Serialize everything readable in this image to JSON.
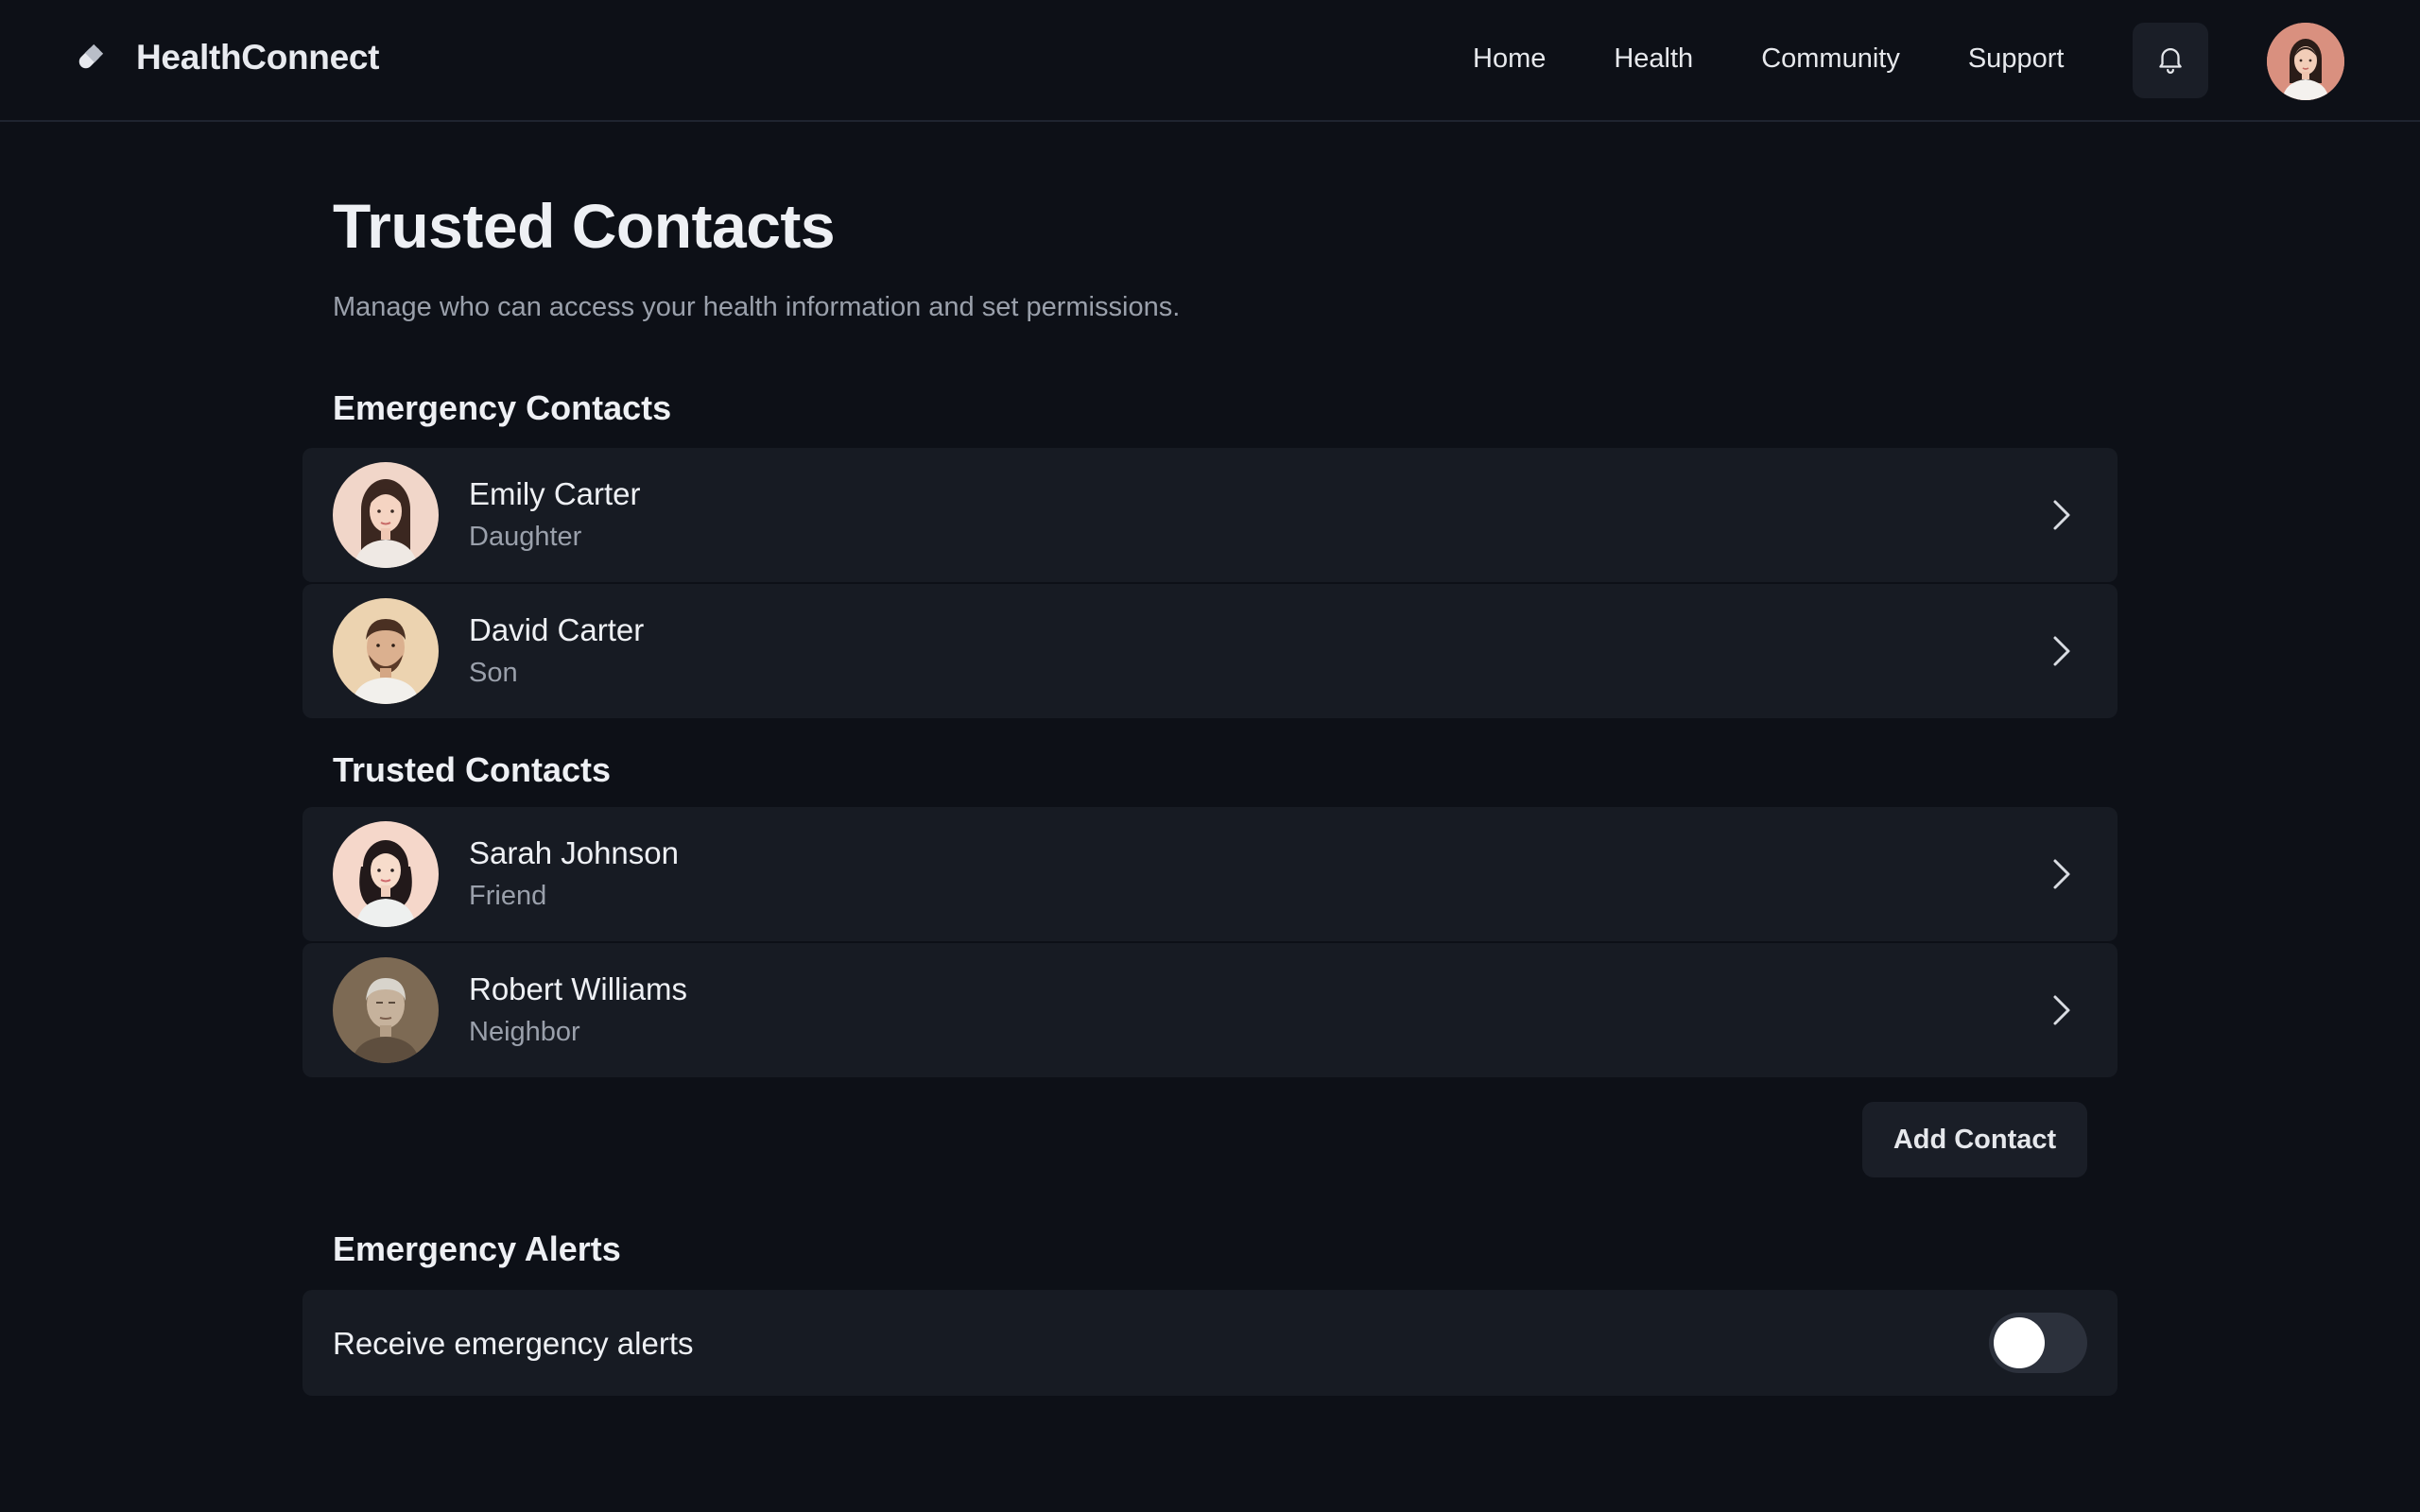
{
  "header": {
    "brand": "HealthConnect",
    "brand_icon": "pill-icon",
    "nav": [
      "Home",
      "Health",
      "Community",
      "Support"
    ],
    "bell_icon": "bell-icon",
    "user_avatar": "user-avatar"
  },
  "page": {
    "title": "Trusted Contacts",
    "subtitle": "Manage who can access your health information and set permissions."
  },
  "emergency": {
    "title": "Emergency Contacts",
    "contacts": [
      {
        "name": "Emily Carter",
        "relation": "Daughter"
      },
      {
        "name": "David Carter",
        "relation": "Son"
      }
    ]
  },
  "trusted": {
    "title": "Trusted Contacts",
    "contacts": [
      {
        "name": "Sarah Johnson",
        "relation": "Friend"
      },
      {
        "name": "Robert Williams",
        "relation": "Neighbor"
      }
    ]
  },
  "actions": {
    "add_contact": "Add Contact"
  },
  "alerts": {
    "title": "Emergency Alerts",
    "receive_label": "Receive emergency alerts",
    "receive_enabled": false
  },
  "colors": {
    "background": "#0d1017",
    "card": "#171b23",
    "muted_text": "#9aa0ab",
    "toggle_off": "#2c313c"
  }
}
